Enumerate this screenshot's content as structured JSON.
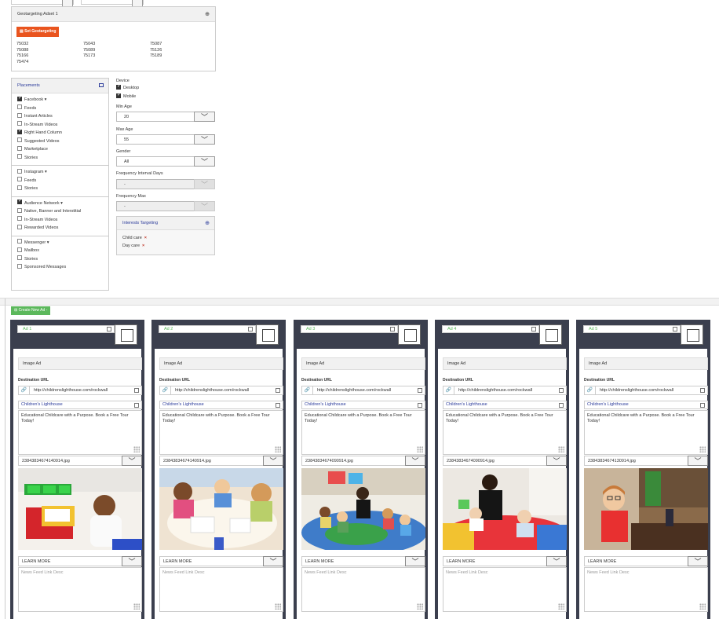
{
  "geotargeting": {
    "title": "Geotargeting Adset 1",
    "button_label": "Set Geotargeting",
    "zips": [
      "75032",
      "75043",
      "75087",
      "75088",
      "75089",
      "75126",
      "75166",
      "75173",
      "75189",
      "75474"
    ]
  },
  "placements": {
    "title": "Placements",
    "groups": [
      {
        "label": "Facebook",
        "checked": true,
        "items": [
          {
            "label": "Feeds",
            "checked": false
          },
          {
            "label": "Instant Articles",
            "checked": false
          },
          {
            "label": "In-Stream Videos",
            "checked": false
          },
          {
            "label": "Right Hand Column",
            "checked": true
          },
          {
            "label": "Suggested Videos",
            "checked": false
          },
          {
            "label": "Marketplace",
            "checked": false
          },
          {
            "label": "Stories",
            "checked": false
          }
        ]
      },
      {
        "label": "Instagram",
        "checked": false,
        "items": [
          {
            "label": "Feeds",
            "checked": false
          },
          {
            "label": "Stories",
            "checked": false
          }
        ]
      },
      {
        "label": "Audience Network",
        "checked": true,
        "items": [
          {
            "label": "Native, Banner and Interstitial",
            "checked": false
          },
          {
            "label": "In-Stream Videos",
            "checked": false
          },
          {
            "label": "Rewarded Videos",
            "checked": false
          }
        ]
      },
      {
        "label": "Messenger",
        "checked": false,
        "items": [
          {
            "label": "Mailbox",
            "checked": false
          },
          {
            "label": "Stories",
            "checked": false
          },
          {
            "label": "Sponsored Messages",
            "checked": false
          }
        ]
      }
    ]
  },
  "targeting": {
    "device_label": "Device",
    "desktop_label": "Desktop",
    "desktop_checked": true,
    "mobile_label": "Mobile",
    "mobile_checked": true,
    "min_age_label": "Min Age",
    "min_age": "20",
    "max_age_label": "Max Age",
    "max_age": "55",
    "gender_label": "Gender",
    "gender": "All",
    "freq_interval_label": "Frequency Interval Days",
    "freq_interval": "-",
    "freq_max_label": "Frequency Max",
    "freq_max": "-",
    "interests_title": "Interests Targeting",
    "interests": [
      "Child care",
      "Day care"
    ]
  },
  "create_ad_label": "Create New Ad -",
  "cards": [
    {
      "name": "Ad 1",
      "type": "Image Ad",
      "dest_label": "Destination URL",
      "url": "http://childrenslighthouse.com/rockwall",
      "headline": "Children's Lighthouse",
      "text": "Educational Childcare with a Purpose. Book a Free Tour Today!",
      "file": "23843834674140914.jpg",
      "cta": "LEARN MORE",
      "desc_placeholder": "News Feed Link Desc",
      "photo": "photo-boy-register"
    },
    {
      "name": "Ad 2",
      "type": "Image Ad",
      "dest_label": "Destination URL",
      "url": "http://childrenslighthouse.com/rockwall",
      "headline": "Children's Lighthouse",
      "text": "Educational Childcare with a Purpose. Book a Free Tour Today!",
      "file": "23843834674140914.jpg",
      "cta": "LEARN MORE",
      "desc_placeholder": "News Feed Link Desc",
      "photo": "photo-kids-drawing"
    },
    {
      "name": "Ad 3",
      "type": "Image Ad",
      "dest_label": "Destination URL",
      "url": "http://childrenslighthouse.com/rockwall",
      "headline": "Children's Lighthouse",
      "text": "Educational Childcare with a Purpose. Book a Free Tour Today!",
      "file": "23843834674090914.jpg",
      "cta": "LEARN MORE",
      "desc_placeholder": "News Feed Link Desc",
      "photo": "photo-circle-time"
    },
    {
      "name": "Ad 4",
      "type": "Image Ad",
      "dest_label": "Destination URL",
      "url": "http://childrenslighthouse.com/rockwall",
      "headline": "Children's Lighthouse",
      "text": "Educational Childcare with a Purpose. Book a Free Tour Today!",
      "file": "23843834674090914.jpg",
      "cta": "LEARN MORE",
      "desc_placeholder": "News Feed Link Desc",
      "photo": "photo-infants"
    },
    {
      "name": "Ad 5",
      "type": "Image Ad",
      "dest_label": "Destination URL",
      "url": "http://childrenslighthouse.com/rockwall",
      "headline": "Children's Lighthouse",
      "text": "Educational Childcare with a Purpose. Book a Free Tour Today!",
      "file": "23843834674130914.jpg",
      "cta": "LEARN MORE",
      "desc_placeholder": "News Feed Link Desc",
      "photo": "photo-girl-glasses"
    }
  ]
}
